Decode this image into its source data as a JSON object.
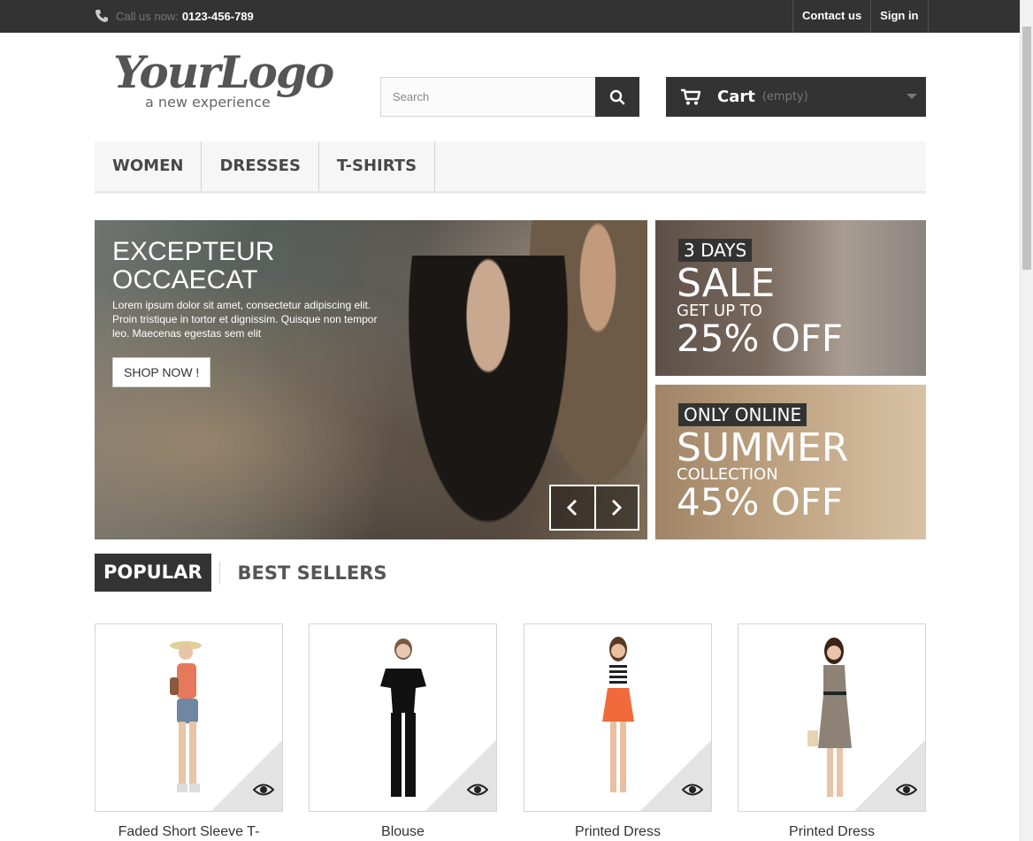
{
  "topbar": {
    "call_label": "Call us now:",
    "phone": "0123-456-789",
    "contact": "Contact us",
    "signin": "Sign in"
  },
  "logo": {
    "script": "YourLogo",
    "tagline": "a new experience"
  },
  "search": {
    "placeholder": "Search"
  },
  "cart": {
    "label": "Cart",
    "status": "(empty)"
  },
  "menu": {
    "items": [
      "WOMEN",
      "DRESSES",
      "T-SHIRTS"
    ]
  },
  "slider": {
    "title": "EXCEPTEUR OCCAECAT",
    "text": "Lorem ipsum dolor sit amet, consectetur adipiscing elit. Proin tristique in tortor et dignissim. Quisque non tempor leo. Maecenas egestas sem elit",
    "button": "SHOP NOW !"
  },
  "banners": [
    {
      "tag": "3 DAYS",
      "big": "SALE",
      "mid": "GET UP TO",
      "pct": "25% OFF"
    },
    {
      "tag": "ONLY ONLINE",
      "big": "SUMMER",
      "mid": "COLLECTION",
      "pct": "45% OFF"
    }
  ],
  "tabs": {
    "active": "POPULAR",
    "other": "BEST SELLERS"
  },
  "products": [
    {
      "name": "Faded Short Sleeve T-"
    },
    {
      "name": "Blouse"
    },
    {
      "name": "Printed Dress"
    },
    {
      "name": "Printed Dress"
    }
  ],
  "colors": {
    "dark": "#333333",
    "menu_bg": "#f6f6f6",
    "border": "#d6d4d4"
  }
}
